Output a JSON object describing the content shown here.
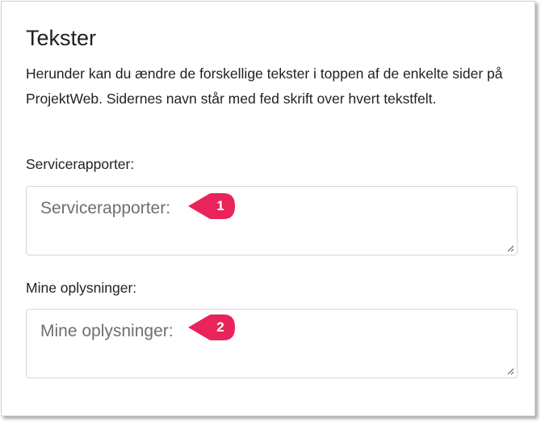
{
  "section": {
    "title": "Tekster",
    "description": "Herunder kan du ændre de forskellige tekster i toppen af de enkelte sider på ProjektWeb. Sidernes navn står med fed skrift over hvert tekstfelt."
  },
  "fields": [
    {
      "label": "Servicerapporter:",
      "placeholder": "Servicerapporter:",
      "callout": "1"
    },
    {
      "label": "Mine oplysninger:",
      "placeholder": "Mine oplysninger:",
      "callout": "2"
    }
  ],
  "colors": {
    "callout": "#e8245a",
    "placeholder": "#6b7075",
    "border": "#d7d7d7"
  },
  "icons": {
    "resize": "resize-grip-icon"
  }
}
